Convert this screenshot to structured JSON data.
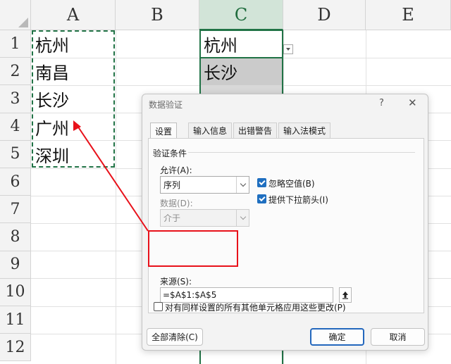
{
  "sheet": {
    "columns": [
      "A",
      "B",
      "C",
      "D",
      "E"
    ],
    "rows": [
      "1",
      "2",
      "3",
      "4",
      "5",
      "6",
      "7",
      "8",
      "9",
      "10",
      "11",
      "12"
    ],
    "col_a_values": [
      "杭州",
      "南昌",
      "长沙",
      "广州",
      "深圳"
    ],
    "col_c_values": [
      "杭州",
      "长沙"
    ]
  },
  "dialog": {
    "title": "数据验证",
    "help": "?",
    "close": "✕",
    "tabs": [
      "设置",
      "输入信息",
      "出错警告",
      "输入法模式"
    ],
    "group_title": "验证条件",
    "allow_label": "允许(A):",
    "allow_value": "序列",
    "data_label": "数据(D):",
    "data_value": "介于",
    "ignore_blank": "忽略空值(B)",
    "dropdown": "提供下拉箭头(I)",
    "source_label": "来源(S):",
    "source_value": "=$A$1:$A$5",
    "apply_all": "对有同样设置的所有其他单元格应用这些更改(P)",
    "clear_all": "全部清除(C)",
    "ok": "确定",
    "cancel": "取消"
  },
  "colors": {
    "excel_green": "#217346",
    "annotation_red": "#e8111a",
    "checkbox_blue": "#1f6fc0"
  }
}
